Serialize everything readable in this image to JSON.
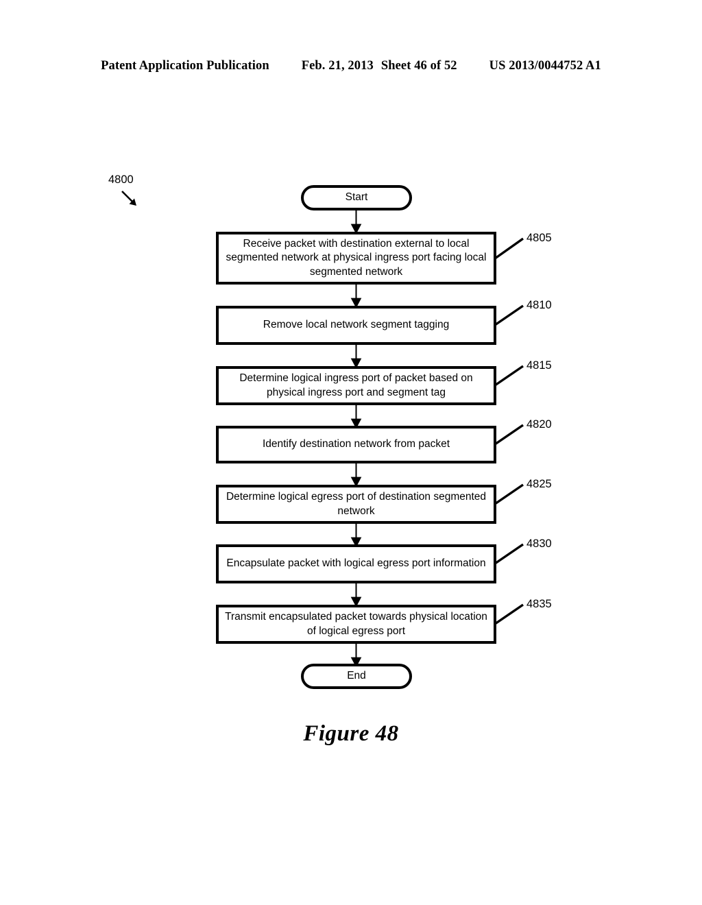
{
  "header": {
    "publication": "Patent Application Publication",
    "date": "Feb. 21, 2013",
    "sheet": "Sheet 46 of 52",
    "patent_number": "US 2013/0044752 A1"
  },
  "figure": {
    "caption": "Figure 48",
    "diagram_label": "4800"
  },
  "flowchart": {
    "start_label": "Start",
    "end_label": "End",
    "steps": [
      {
        "ref": "4805",
        "text": "Receive packet with destination external to local segmented network at physical ingress port facing local segmented network"
      },
      {
        "ref": "4810",
        "text": "Remove local network segment tagging"
      },
      {
        "ref": "4815",
        "text": "Determine logical ingress port of packet based on physical ingress port and segment tag"
      },
      {
        "ref": "4820",
        "text": "Identify destination network from packet"
      },
      {
        "ref": "4825",
        "text": "Determine logical egress port of destination segmented network"
      },
      {
        "ref": "4830",
        "text": "Encapsulate packet with logical egress port information"
      },
      {
        "ref": "4835",
        "text": "Transmit encapsulated packet towards physical location of logical egress port"
      }
    ]
  },
  "colors": {
    "ink": "#000000",
    "paper": "#ffffff"
  }
}
